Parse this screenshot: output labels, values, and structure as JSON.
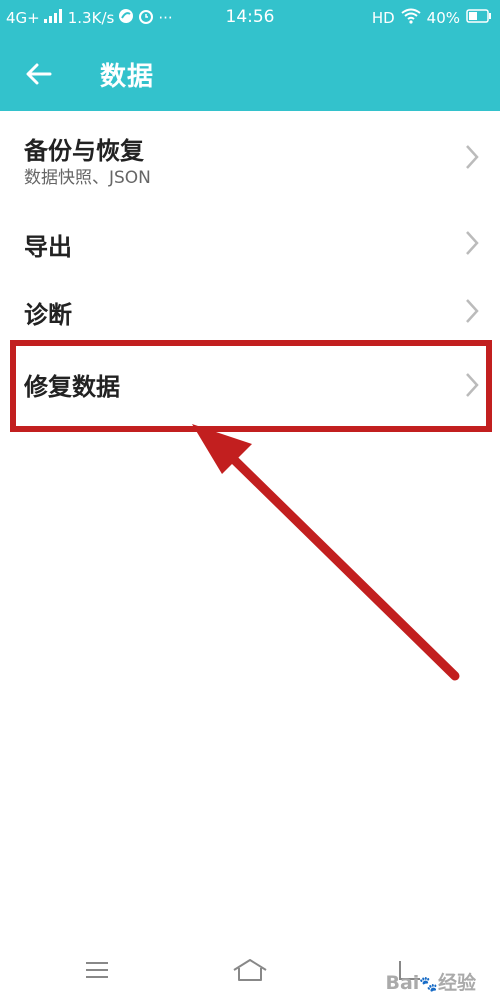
{
  "status_bar": {
    "network": "4G+",
    "speed": "1.3K/s",
    "dots": "···",
    "time": "14:56",
    "hd": "HD",
    "battery": "40%"
  },
  "toolbar": {
    "title": "数据",
    "icons": {
      "back": "back-arrow-icon"
    }
  },
  "settings": [
    {
      "title": "备份与恢复",
      "subtitle": "数据快照、JSON"
    },
    {
      "title": "导出"
    },
    {
      "title": "诊断"
    },
    {
      "title": "修复数据"
    }
  ],
  "annotation": {
    "color": "#c21f1f"
  },
  "colors": {
    "accent": "#33c2cc",
    "annotation": "#c21f1f"
  }
}
